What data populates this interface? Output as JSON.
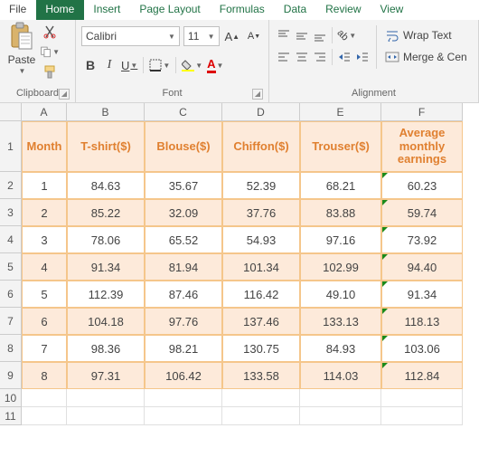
{
  "tabs": {
    "file": "File",
    "home": "Home",
    "insert": "Insert",
    "pagelayout": "Page Layout",
    "formulas": "Formulas",
    "data": "Data",
    "review": "Review",
    "view": "View"
  },
  "ribbon": {
    "clipboard": {
      "paste": "Paste",
      "title": "Clipboard"
    },
    "font": {
      "name": "Calibri",
      "size": "11",
      "title": "Font"
    },
    "align": {
      "wrap": "Wrap Text",
      "merge": "Merge & Cen",
      "title": "Alignment"
    }
  },
  "columns": [
    "A",
    "B",
    "C",
    "D",
    "E",
    "F"
  ],
  "row_numbers": [
    "1",
    "2",
    "3",
    "4",
    "5",
    "6",
    "7",
    "8",
    "9",
    "10",
    "11"
  ],
  "headers": {
    "month": "Month",
    "tshirt": "T-shirt($)",
    "blouse": "Blouse($)",
    "chiffon": "Chiffon($)",
    "trouser": "Trouser($)",
    "avg": "Average monthly earnings"
  },
  "table": [
    {
      "m": "1",
      "t": "84.63",
      "b": "35.67",
      "c": "52.39",
      "r": "68.21",
      "a": "60.23"
    },
    {
      "m": "2",
      "t": "85.22",
      "b": "32.09",
      "c": "37.76",
      "r": "83.88",
      "a": "59.74"
    },
    {
      "m": "3",
      "t": "78.06",
      "b": "65.52",
      "c": "54.93",
      "r": "97.16",
      "a": "73.92"
    },
    {
      "m": "4",
      "t": "91.34",
      "b": "81.94",
      "c": "101.34",
      "r": "102.99",
      "a": "94.40"
    },
    {
      "m": "5",
      "t": "112.39",
      "b": "87.46",
      "c": "116.42",
      "r": "49.10",
      "a": "91.34"
    },
    {
      "m": "6",
      "t": "104.18",
      "b": "97.76",
      "c": "137.46",
      "r": "133.13",
      "a": "118.13"
    },
    {
      "m": "7",
      "t": "98.36",
      "b": "98.21",
      "c": "130.75",
      "r": "84.93",
      "a": "103.06"
    },
    {
      "m": "8",
      "t": "97.31",
      "b": "106.42",
      "c": "133.58",
      "r": "114.03",
      "a": "112.84"
    }
  ]
}
